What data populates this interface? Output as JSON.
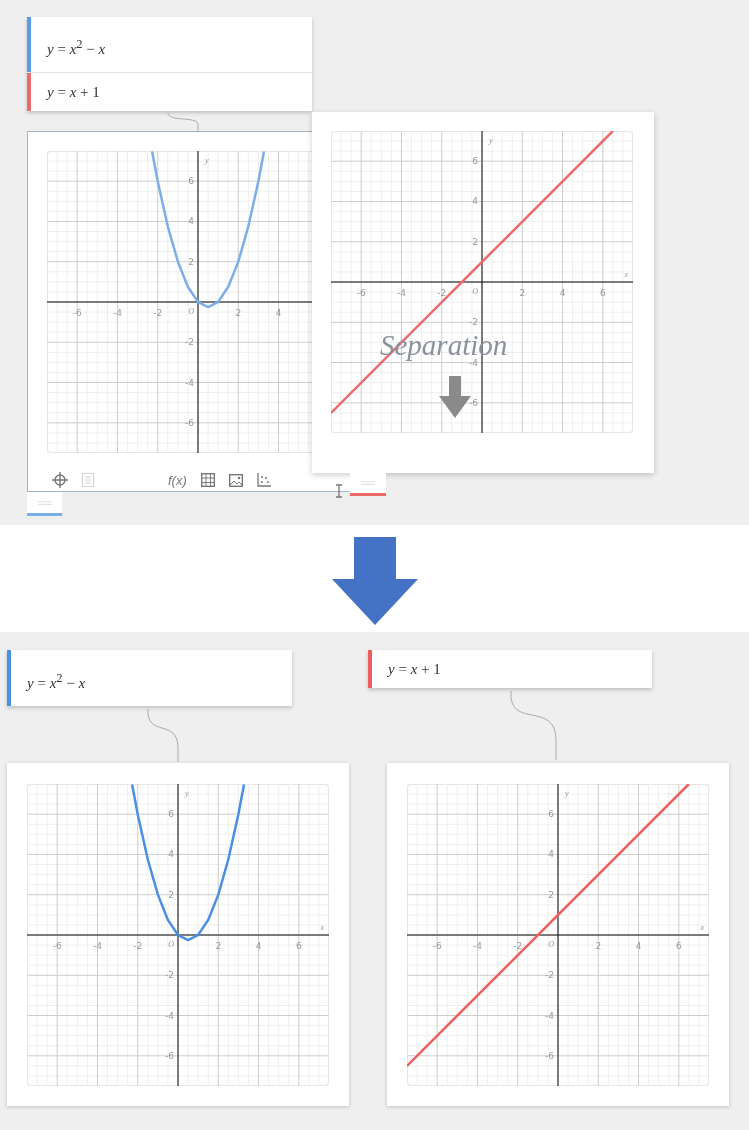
{
  "before": {
    "formula_panel": {
      "rows": [
        {
          "formula": "*y* = *x*$^{2}$ − *x*",
          "color": "#5b9be6"
        },
        {
          "formula": "*y* = *x* + 1",
          "color": "#e86a6a"
        }
      ]
    },
    "graph_windows": [
      {
        "toolbar": [
          {
            "kind": "crosshair",
            "disabled": false
          },
          {
            "kind": "list",
            "disabled": true
          },
          {
            "kind": "function",
            "label": "f(x)",
            "disabled": false
          },
          {
            "kind": "table",
            "disabled": false
          },
          {
            "kind": "image",
            "disabled": false
          },
          {
            "kind": "points",
            "disabled": false
          },
          {
            "kind": "text-cursor",
            "disabled": false
          }
        ],
        "color": "#7aaee8",
        "chart_data": {
          "type": "line",
          "ylabel": "y",
          "xlim": [
            -7.5,
            7.5
          ],
          "ylim": [
            -7.5,
            7.5
          ],
          "grid": true,
          "xticks": [
            -6,
            -4,
            -2,
            2,
            4
          ],
          "yticks": [
            -6,
            -4,
            -2,
            2,
            4,
            6
          ],
          "annotations": [
            "O"
          ],
          "x": [
            -2.28,
            -2,
            -1.5,
            -1,
            -0.5,
            0,
            0.5,
            1,
            1.5,
            2,
            2.5,
            3,
            3.28
          ],
          "series": [
            {
              "color": "#7aaee8",
              "values": [
                7.48,
                6,
                3.75,
                2,
                0.75,
                0,
                -0.25,
                0,
                0.75,
                2,
                3.75,
                6,
                7.48
              ]
            }
          ]
        }
      },
      {
        "color": "#e86a6a",
        "chart_data": {
          "type": "line",
          "xlabel": "x",
          "ylabel": "y",
          "xlim": [
            -7.5,
            7.5
          ],
          "ylim": [
            -7.5,
            7.5
          ],
          "grid": true,
          "xticks": [
            -6,
            -4,
            -2,
            2,
            4,
            6
          ],
          "yticks": [
            -6,
            -4,
            -2,
            2,
            4,
            6
          ],
          "annotations": [
            "O"
          ],
          "x": [
            -7.5,
            6.5
          ],
          "series": [
            {
              "color": "#ee6a6a",
              "values": [
                -6.5,
                7.5
              ]
            }
          ]
        }
      }
    ],
    "overlay_label": "Separation"
  },
  "after": {
    "formula_cards": [
      {
        "formula": "*y* = *x*$^{2}$ − *x*",
        "color": "#4a90e2"
      },
      {
        "formula": "*y* = *x* + 1",
        "color": "#ee5e5e"
      }
    ],
    "graph_windows": [
      {
        "chart_data": {
          "type": "line",
          "xlabel": "x",
          "ylabel": "y",
          "xlim": [
            -7.5,
            7.5
          ],
          "ylim": [
            -7.5,
            7.5
          ],
          "grid": true,
          "xticks": [
            -6,
            -4,
            -2,
            2,
            4,
            6
          ],
          "yticks": [
            -6,
            -4,
            -2,
            2,
            4,
            6
          ],
          "annotations": [
            "O"
          ],
          "x": [
            -2.28,
            -2,
            -1.5,
            -1,
            -0.5,
            0,
            0.5,
            1,
            1.5,
            2,
            2.5,
            3,
            3.28
          ],
          "series": [
            {
              "color": "#4a90e2",
              "values": [
                7.48,
                6,
                3.75,
                2,
                0.75,
                0,
                -0.25,
                0,
                0.75,
                2,
                3.75,
                6,
                7.48
              ]
            }
          ]
        }
      },
      {
        "chart_data": {
          "type": "line",
          "xlabel": "x",
          "ylabel": "y",
          "xlim": [
            -7.5,
            7.5
          ],
          "ylim": [
            -7.5,
            7.5
          ],
          "grid": true,
          "xticks": [
            -6,
            -4,
            -2,
            2,
            4,
            6
          ],
          "yticks": [
            -6,
            -4,
            -2,
            2,
            4,
            6
          ],
          "annotations": [
            "O"
          ],
          "x": [
            -7.5,
            6.5
          ],
          "series": [
            {
              "color": "#ee5e5e",
              "values": [
                -6.5,
                7.5
              ]
            }
          ]
        }
      }
    ]
  }
}
